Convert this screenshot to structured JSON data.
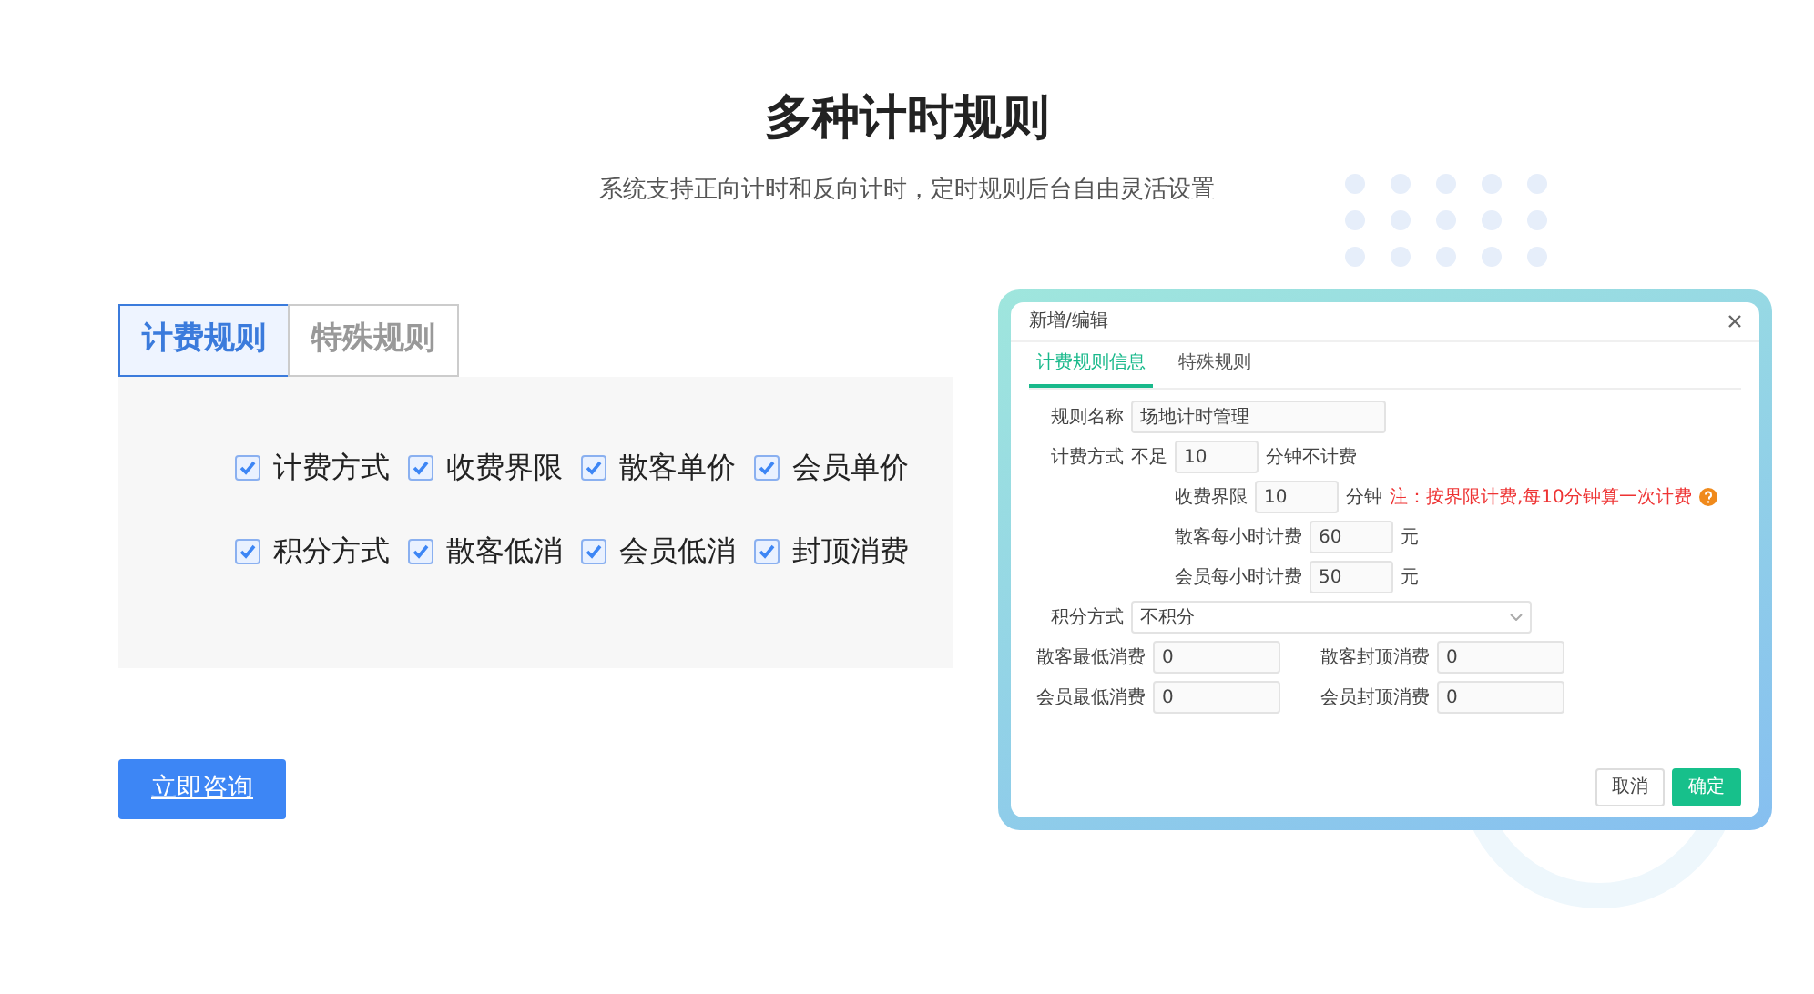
{
  "heading": "多种计时规则",
  "subtitle": "系统支持正向计时和反向计时，定时规则后台自由灵活设置",
  "tabs": [
    {
      "label": "计费规则",
      "selected": true
    },
    {
      "label": "特殊规则",
      "selected": false
    }
  ],
  "options": [
    {
      "label": "计费方式",
      "checked": true
    },
    {
      "label": "收费界限",
      "checked": true
    },
    {
      "label": "散客单价",
      "checked": true
    },
    {
      "label": "会员单价",
      "checked": true
    },
    {
      "label": "积分方式",
      "checked": true
    },
    {
      "label": "散客低消",
      "checked": true
    },
    {
      "label": "会员低消",
      "checked": true
    },
    {
      "label": "封顶消费",
      "checked": true
    }
  ],
  "consult_button": "立即咨询",
  "dialog": {
    "title": "新增/编辑",
    "tabs": [
      {
        "label": "计费规则信息",
        "selected": true
      },
      {
        "label": "特殊规则",
        "selected": false
      }
    ],
    "rows": [
      {
        "kind": "input",
        "label": "规则名称",
        "value": "场地计时管理"
      },
      {
        "kind": "prefix",
        "label": "计费方式",
        "prefix": "不足",
        "value": "10",
        "suffix": "分钟不计费"
      },
      {
        "kind": "sub",
        "label": "收费界限",
        "value": "10",
        "suffix": "分钟",
        "note": "注：按界限计费,每10分钟算一次计费"
      },
      {
        "kind": "sub",
        "label": "散客每小时计费",
        "value": "60",
        "suffix": "元"
      },
      {
        "kind": "sub",
        "label": "会员每小时计费",
        "value": "50",
        "suffix": "元"
      },
      {
        "kind": "select",
        "label": "积分方式",
        "value": "不积分"
      },
      {
        "kind": "pair",
        "items": [
          {
            "label": "散客最低消费",
            "value": "0"
          },
          {
            "label": "散客封顶消费",
            "value": "0"
          }
        ]
      },
      {
        "kind": "pair",
        "items": [
          {
            "label": "会员最低消费",
            "value": "0"
          },
          {
            "label": "会员封顶消费",
            "value": "0"
          }
        ]
      }
    ],
    "buttons": [
      {
        "label": "取消",
        "primary": false
      },
      {
        "label": "确定",
        "primary": true
      }
    ]
  }
}
